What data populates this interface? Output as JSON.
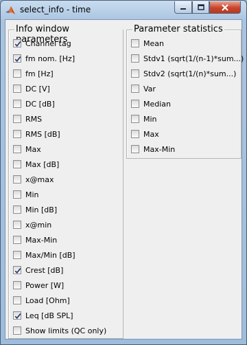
{
  "window": {
    "title": "select_info - time"
  },
  "left_panel": {
    "title": "Info window parameters",
    "items": [
      {
        "label": "Channel tag",
        "checked": true
      },
      {
        "label": "fm nom. [Hz]",
        "checked": true
      },
      {
        "label": "fm [Hz]",
        "checked": false
      },
      {
        "label": "DC [V]",
        "checked": false
      },
      {
        "label": "DC [dB]",
        "checked": false
      },
      {
        "label": "RMS",
        "checked": false
      },
      {
        "label": "RMS [dB]",
        "checked": false
      },
      {
        "label": "Max",
        "checked": false
      },
      {
        "label": "Max [dB]",
        "checked": false
      },
      {
        "label": "x@max",
        "checked": false
      },
      {
        "label": "Min",
        "checked": false
      },
      {
        "label": "Min [dB]",
        "checked": false
      },
      {
        "label": "x@min",
        "checked": false
      },
      {
        "label": "Max-Min",
        "checked": false
      },
      {
        "label": "Max/Min [dB]",
        "checked": false
      },
      {
        "label": "Crest [dB]",
        "checked": true
      },
      {
        "label": "Power [W]",
        "checked": false
      },
      {
        "label": "Load [Ohm]",
        "checked": false
      },
      {
        "label": "Leq [dB SPL]",
        "checked": true
      },
      {
        "label": "Show limits (QC only)",
        "checked": false
      }
    ]
  },
  "right_panel": {
    "title": "Parameter statistics",
    "items": [
      {
        "label": "Mean",
        "checked": false
      },
      {
        "label": "Stdv1 (sqrt(1/(n-1)*sum...)",
        "checked": false
      },
      {
        "label": "Stdv2 (sqrt(1/(n)*sum...)",
        "checked": false
      },
      {
        "label": "Var",
        "checked": false
      },
      {
        "label": "Median",
        "checked": false
      },
      {
        "label": "Min",
        "checked": false
      },
      {
        "label": "Max",
        "checked": false
      },
      {
        "label": "Max-Min",
        "checked": false
      }
    ]
  }
}
